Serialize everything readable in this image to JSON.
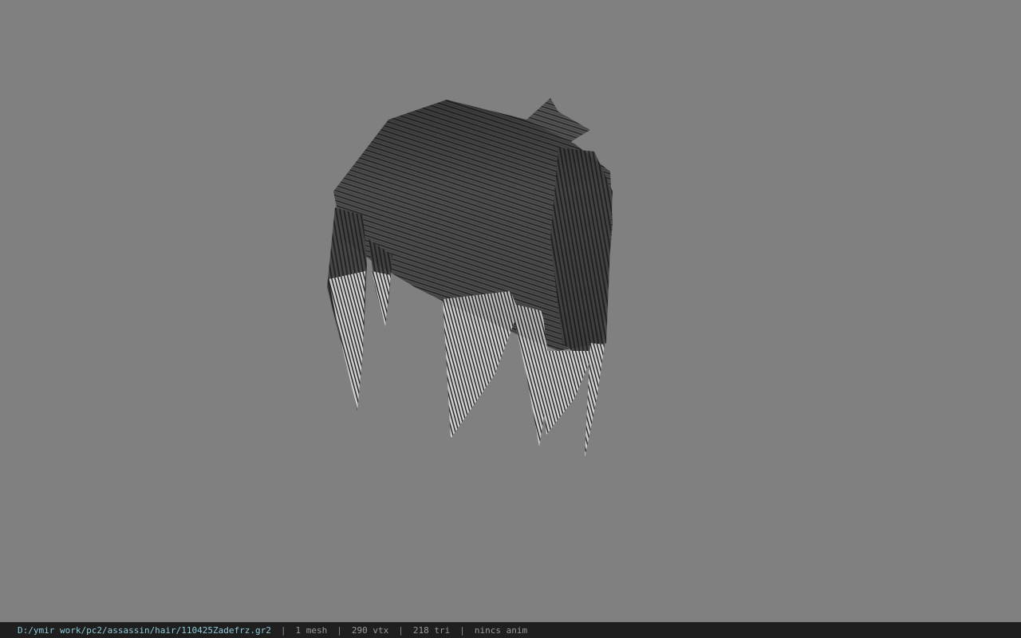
{
  "status_bar": {
    "file_path": "D:/ymir work/pc2/assassin/hair/110425Zadefrz.gr2",
    "separator": "|",
    "mesh_count": "1 mesh",
    "vertex_count": "290 vtx",
    "triangle_count": "218 tri",
    "animation": "nincs anim"
  },
  "colors": {
    "background": "#808080",
    "status_bar_bg": "#1f1f1f",
    "path_text": "#8fc9d8",
    "info_text": "#9a9a9a"
  }
}
